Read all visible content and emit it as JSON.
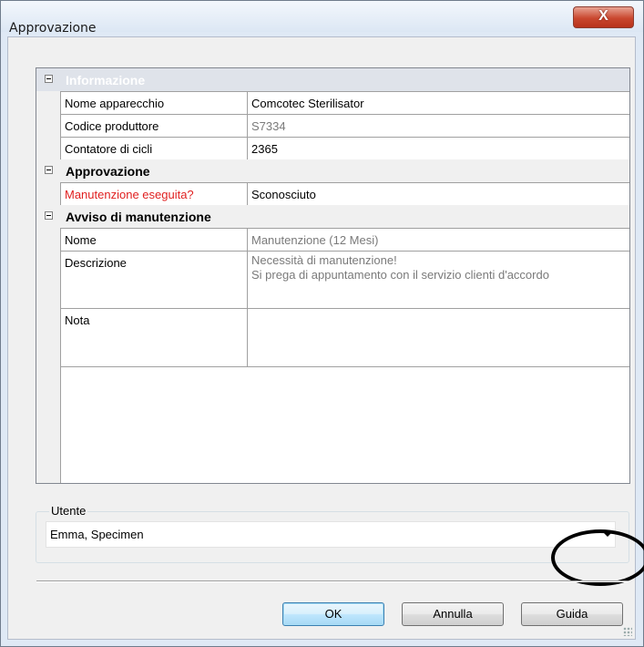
{
  "window": {
    "title": "Approvazione",
    "close_glyph": "X"
  },
  "grid": {
    "categories": [
      {
        "label": "Informazione",
        "rows": [
          {
            "name": "Nome apparecchio",
            "value": "Comcotec Sterilisator"
          },
          {
            "name": "Codice produttore",
            "value": "S7334"
          },
          {
            "name": "Contatore di cicli",
            "value": "2365"
          }
        ]
      },
      {
        "label": "Approvazione",
        "rows": [
          {
            "name": "Manutenzione eseguita?",
            "value": "Sconosciuto"
          }
        ]
      },
      {
        "label": "Avviso di manutenzione",
        "rows": [
          {
            "name": "Nome",
            "value": "Manutenzione (12 Mesi)"
          },
          {
            "name": "Descrizione",
            "value_line1": "Necessità di manutenzione!",
            "value_line2": "Si prega di appuntamento con il servizio clienti d'accordo"
          },
          {
            "name": "Nota",
            "value": ""
          }
        ]
      }
    ]
  },
  "user_group": {
    "label": "Utente",
    "selected": "Emma, Specimen"
  },
  "buttons": {
    "ok": "OK",
    "cancel": "Annulla",
    "help": "Guida"
  },
  "colors": {
    "required_label": "#e02020",
    "readonly_value": "#7a7a7a"
  }
}
